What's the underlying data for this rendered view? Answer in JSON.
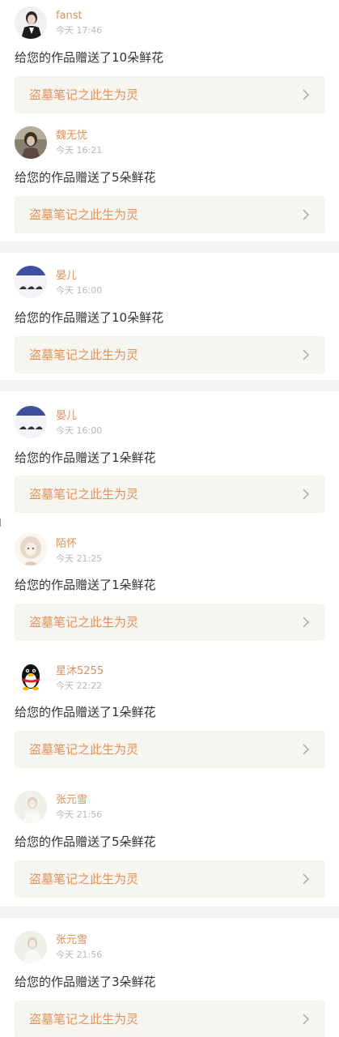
{
  "colors": {
    "username": "#e0905a",
    "time": "#b8b8b8",
    "message": "#333333",
    "link_bg": "#f6f5ef",
    "link_text": "#e8905a",
    "divider": "#f3f3f3"
  },
  "items": [
    {
      "user": "fanst",
      "time": "今天 17:46",
      "message": "给您的作品赠送了10朵鲜花",
      "work": "盗墓笔记之此生为灵",
      "avatar_icon": "person-avatar-icon"
    },
    {
      "user": "魏无忧",
      "time": "今天 16:21",
      "message": "给您的作品赠送了5朵鲜花",
      "work": "盗墓笔记之此生为灵",
      "avatar_icon": "person-avatar-icon"
    },
    {
      "user": "晏儿",
      "time": "今天 16:00",
      "message": "给您的作品赠送了10朵鲜花",
      "work": "盗墓笔记之此生为灵",
      "avatar_icon": "text-avatar-icon"
    },
    {
      "user": "晏儿",
      "time": "今天 16:00",
      "message": "给您的作品赠送了1朵鲜花",
      "work": "盗墓笔记之此生为灵",
      "avatar_icon": "text-avatar-icon"
    },
    {
      "user": "陌怀",
      "time": "今天 21:25",
      "message": "给您的作品赠送了1朵鲜花",
      "work": "盗墓笔记之此生为灵",
      "avatar_icon": "anime-girl-avatar-icon"
    },
    {
      "user": "星沐5255",
      "time": "今天 22:22",
      "message": "给您的作品赠送了1朵鲜花",
      "work": "盗墓笔记之此生为灵",
      "avatar_icon": "penguin-avatar-icon"
    },
    {
      "user": "张元雪",
      "time": "今天 21:56",
      "message": "给您的作品赠送了5朵鲜花",
      "work": "盗墓笔记之此生为灵",
      "avatar_icon": "person-avatar-icon"
    },
    {
      "user": "张元雪",
      "time": "今天 21:56",
      "message": "给您的作品赠送了3朵鲜花",
      "work": "盗墓笔记之此生为灵",
      "avatar_icon": "person-avatar-icon"
    }
  ]
}
